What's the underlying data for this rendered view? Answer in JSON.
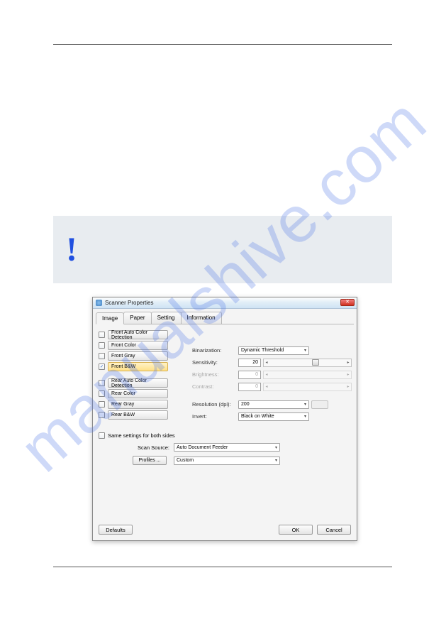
{
  "watermark": "manualshive.com",
  "dialog": {
    "title": "Scanner Properties",
    "tabs": [
      "Image",
      "Paper",
      "Setting",
      "Information"
    ],
    "active_tab": 0,
    "front": [
      {
        "label": "Front Auto Color Detection",
        "checked": false
      },
      {
        "label": "Front Color",
        "checked": false
      },
      {
        "label": "Front Gray",
        "checked": false
      },
      {
        "label": "Front B&W",
        "checked": true
      }
    ],
    "rear": [
      {
        "label": "Rear Auto Color Detection",
        "checked": false
      },
      {
        "label": "Rear Color",
        "checked": false
      },
      {
        "label": "Rear Gray",
        "checked": false
      },
      {
        "label": "Rear B&W",
        "checked": false
      }
    ],
    "fields": {
      "binarization_label": "Binarization:",
      "binarization_value": "Dynamic Threshold",
      "sensitivity_label": "Sensitivity:",
      "sensitivity_value": "20",
      "brightness_label": "Brightness:",
      "brightness_value": "0",
      "contrast_label": "Contrast:",
      "contrast_value": "0",
      "resolution_label": "Resolution (dpi):",
      "resolution_value": "200",
      "invert_label": "Invert:",
      "invert_value": "Black on White"
    },
    "same_settings_label": "Same settings for both sides",
    "same_settings_checked": false,
    "scan_source_label": "Scan Source:",
    "scan_source_value": "Auto Document Feeder",
    "profiles_btn": "Profiles ...",
    "profiles_value": "Custom",
    "buttons": {
      "defaults": "Defaults",
      "ok": "OK",
      "cancel": "Cancel"
    }
  }
}
